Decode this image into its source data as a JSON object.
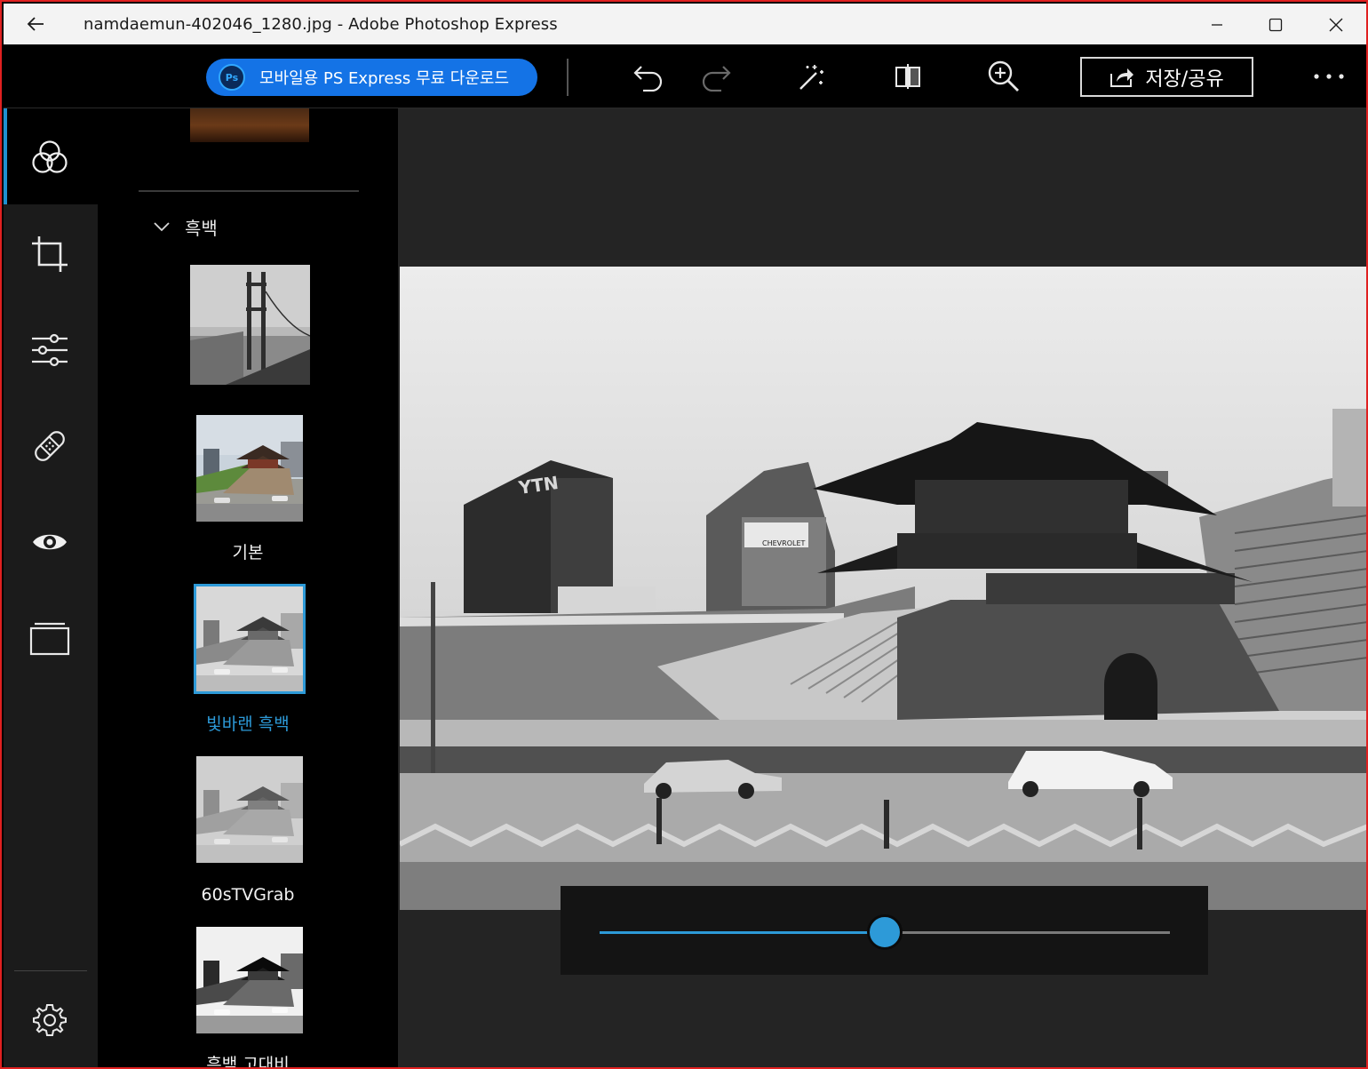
{
  "window": {
    "title": "namdaemun-402046_1280.jpg - Adobe Photoshop Express"
  },
  "toolbar": {
    "promo_label": "모바일용 PS Express 무료 다운로드",
    "promo_logo": "Ps",
    "save_share_label": "저장/공유",
    "icons": [
      "undo-icon",
      "redo-icon",
      "auto-fix-icon",
      "compare-icon",
      "zoom-in-icon",
      "more-icon"
    ]
  },
  "rail": {
    "items": [
      "looks-icon",
      "crop-icon",
      "adjustments-icon",
      "healing-icon",
      "eye-icon",
      "borders-icon"
    ],
    "active": "looks-icon",
    "settings": "settings-icon"
  },
  "filters": {
    "section_label": "흑백",
    "items": [
      {
        "name": ""
      },
      {
        "name": "기본"
      },
      {
        "name": "빛바랜 흑백",
        "selected": true
      },
      {
        "name": "60sTVGrab"
      },
      {
        "name": "흑백 고대비"
      }
    ]
  },
  "intensity_slider": {
    "value": 0.5
  },
  "colors": {
    "accent": "#2d9ad8",
    "promo": "#1473e6",
    "titlebar": "#f3f3f3",
    "rail": "#1b1b1b",
    "canvas": "#242424"
  }
}
